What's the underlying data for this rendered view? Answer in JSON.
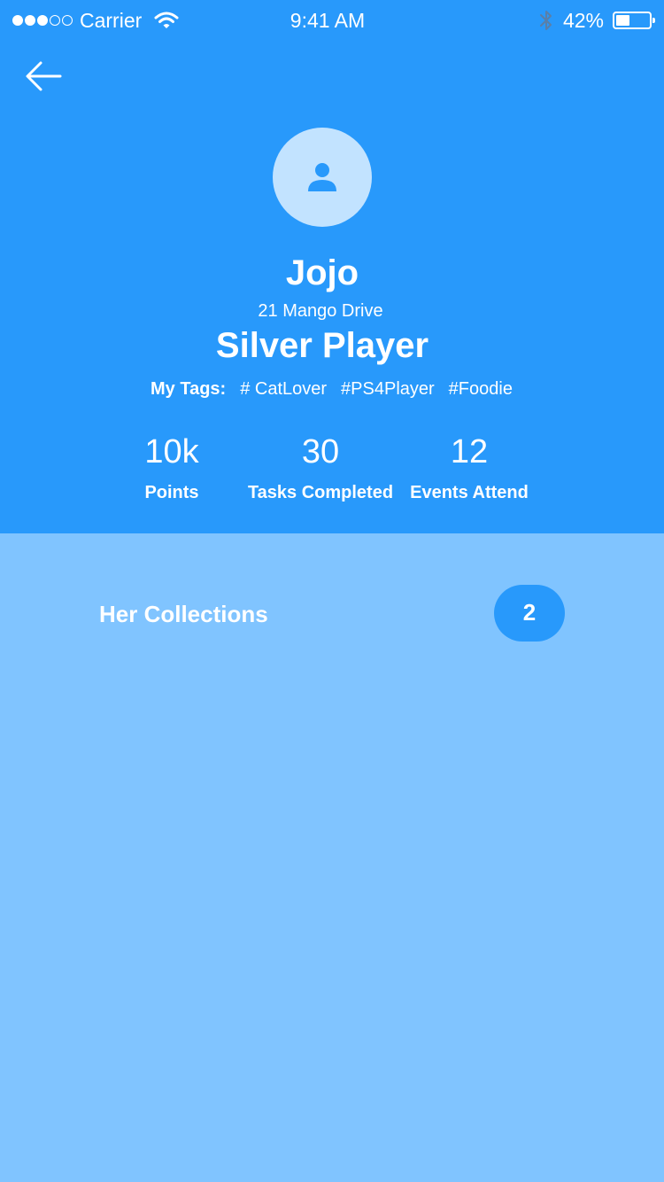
{
  "status_bar": {
    "carrier": "Carrier",
    "time": "9:41 AM",
    "battery": "42%",
    "battery_level": 0.42,
    "signal_strength": 3,
    "signal_max": 5,
    "icons": [
      "signal-dots-icon",
      "wifi-icon",
      "bluetooth-icon",
      "battery-icon"
    ]
  },
  "nav": {
    "back_icon": "back-arrow-icon"
  },
  "profile": {
    "avatar_icon": "user-icon",
    "name": "Jojo",
    "address": "21 Mango Drive",
    "level": "Silver Player",
    "tags_label": "My Tags:",
    "tags": [
      "# CatLover",
      "#PS4Player",
      "#Foodie"
    ]
  },
  "stats": [
    {
      "value": "10k",
      "label": "Points"
    },
    {
      "value": "30",
      "label": "Tasks Completed"
    },
    {
      "value": "12",
      "label": "Events Attend"
    }
  ],
  "collections": {
    "title": "Her Collections",
    "count": "2"
  },
  "colors": {
    "header_bg": "#2899fb",
    "body_bg": "#80c4ff",
    "avatar_bg": "#c2e3ff",
    "badge_bg": "#2899fb",
    "text": "#ffffff",
    "status_icon_gray": "#5a7fa8"
  }
}
